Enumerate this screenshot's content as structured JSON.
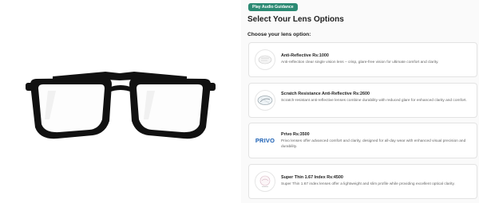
{
  "audio_button": {
    "label": "Play Audio Guidance"
  },
  "header": {
    "title": "Select Your Lens Options",
    "subtitle": "Choose your lens option:"
  },
  "options": [
    {
      "title": "Anti-Reflective Rs:1000",
      "description": "Anti-reflection clear single vision lens – crisp, glare-free vision for ultimate comfort and clarity.",
      "icon": "anti-reflective-lens-icon"
    },
    {
      "title": "Scratch Resistance Anti-Reflective Rs:2600",
      "description": "Scratch-resistant anti-reflective lenses combine durability with reduced glare for enhanced clarity and comfort.",
      "icon": "scratch-resistant-lens-icon"
    },
    {
      "title": "Privo Rs:3500",
      "description": "Privo lenses offer advanced comfort and clarity, designed for all-day wear with enhanced visual precision and durability.",
      "logo_text": "PRIVO",
      "icon": "privo-logo"
    },
    {
      "title": "Super Thin 1.67 Index Rs:4500",
      "description": "Super Thin 1.67 index lenses offer a lightweight and slim profile while providing excellent optical clarity.",
      "icon": "super-thin-lens-icon"
    }
  ],
  "colors": {
    "accent": "#2c8a73",
    "frame": "#111111",
    "privo_blue": "#1a5fb4"
  }
}
